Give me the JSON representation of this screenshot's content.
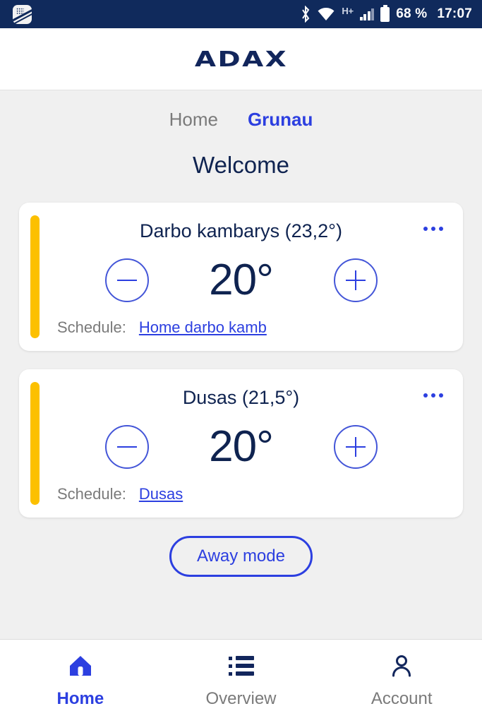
{
  "status_bar": {
    "app_badge_icon": "app-notification-icon",
    "bluetooth_icon": "bluetooth-icon",
    "wifi_icon": "wifi-icon",
    "network_type": "H+",
    "signal_icon": "signal-bars-icon",
    "battery_icon": "battery-icon",
    "battery_percent": "68 %",
    "time": "17:07"
  },
  "header": {
    "logo_text": "ADAX"
  },
  "tabs": [
    {
      "label": "Home",
      "active": false
    },
    {
      "label": "Grunau",
      "active": true
    }
  ],
  "page_title": "Welcome",
  "rooms": [
    {
      "title": "Darbo kambarys (23,2°)",
      "setpoint": "20°",
      "schedule_label": "Schedule:",
      "schedule_name": "Home darbo kamb",
      "accent_color": "#fcc000",
      "decrease_icon": "minus-icon",
      "increase_icon": "plus-icon",
      "menu_icon": "more-options-icon"
    },
    {
      "title": "Dusas (21,5°)",
      "setpoint": "20°",
      "schedule_label": "Schedule:",
      "schedule_name": "Dusas",
      "accent_color": "#fcc000",
      "decrease_icon": "minus-icon",
      "increase_icon": "plus-icon",
      "menu_icon": "more-options-icon"
    }
  ],
  "away_button": {
    "label": "Away mode"
  },
  "bottom_nav": [
    {
      "label": "Home",
      "icon": "home-icon",
      "active": true
    },
    {
      "label": "Overview",
      "icon": "list-icon",
      "active": false
    },
    {
      "label": "Account",
      "icon": "person-icon",
      "active": false
    }
  ],
  "colors": {
    "brand_navy": "#12265c",
    "accent_blue": "#2c3fe0",
    "accent_yellow": "#fcc000",
    "muted_gray": "#7a7a7a",
    "page_bg": "#f0f0f0"
  }
}
